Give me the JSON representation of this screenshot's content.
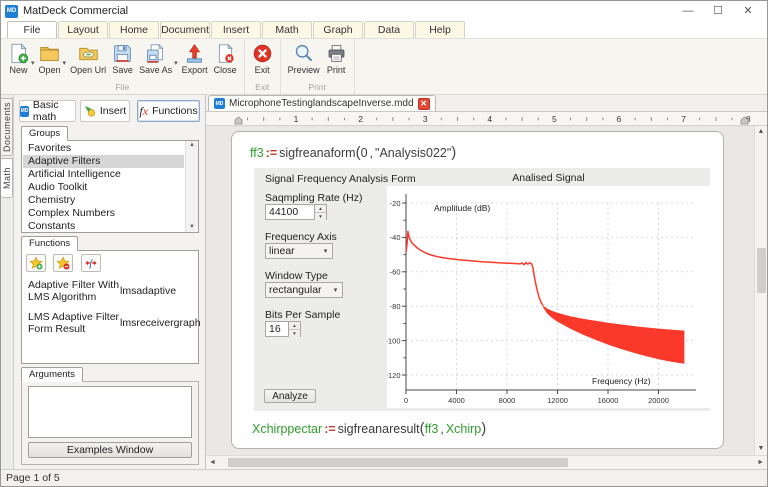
{
  "window": {
    "title": "MatDeck Commercial"
  },
  "icons": {
    "dropdown": "▾",
    "spin_up": "▲",
    "spin_down": "▼",
    "scroll_up": "▲",
    "scroll_down": "▼",
    "scroll_left": "◄",
    "scroll_right": "►",
    "minimize": "—",
    "maximize": "☐",
    "close": "✕",
    "tab_close": "✕",
    "md_logo": "MD"
  },
  "ribbon": {
    "tabs": [
      {
        "label": "File",
        "active": true
      },
      {
        "label": "Layout"
      },
      {
        "label": "Home"
      },
      {
        "label": "Document"
      },
      {
        "label": "Insert"
      },
      {
        "label": "Math"
      },
      {
        "label": "Graph"
      },
      {
        "label": "Data"
      },
      {
        "label": "Help"
      }
    ],
    "groups": [
      {
        "caption": "File",
        "buttons": [
          {
            "label": "New"
          },
          {
            "label": "Open"
          },
          {
            "label": "Open Url"
          },
          {
            "label": "Save"
          },
          {
            "label": "Save As"
          },
          {
            "label": "Export"
          },
          {
            "label": "Close"
          }
        ]
      },
      {
        "caption": "Exit",
        "buttons": [
          {
            "label": "Exit"
          }
        ]
      },
      {
        "caption": "Print",
        "buttons": [
          {
            "label": "Preview"
          },
          {
            "label": "Print"
          }
        ]
      }
    ]
  },
  "side_tabs": [
    {
      "label": "Documents"
    },
    {
      "label": "Math",
      "active": true
    }
  ],
  "left_panel": {
    "view_tabs": [
      {
        "label": "Basic math"
      },
      {
        "label": "Insert"
      },
      {
        "label": "Functions",
        "active": true
      }
    ],
    "groups": {
      "tab_label": "Groups",
      "items": [
        "Favorites",
        "Adaptive Filters",
        "Artificial Intelligence",
        "Audio Toolkit",
        "Chemistry",
        "Complex Numbers",
        "Constants"
      ],
      "selected_index": 1
    },
    "functions": {
      "tab_label": "Functions",
      "entries": [
        {
          "name": "Adaptive Filter With LMS Algorithm",
          "id": "lmsadaptive"
        },
        {
          "name": "LMS Adaptive Filter Form Result",
          "id": "lmsreceivergraph"
        }
      ]
    },
    "arguments": {
      "tab_label": "Arguments",
      "examples_button": "Examples Window"
    }
  },
  "document": {
    "tab": {
      "filename": "MicrophoneTestinglandscapeInverse.mdd"
    },
    "ruler_numbers": [
      "1",
      "2",
      "3",
      "4",
      "5",
      "6",
      "7",
      "8"
    ],
    "formula1": {
      "lhs": "ff3",
      "assign": ":=",
      "func": "sigfreanaform",
      "open": "(",
      "arg1": "0",
      "comma": ",",
      "arg2": "\"Analysis022\"",
      "close": ")"
    },
    "formula2": {
      "lhs": "Xchirppectar",
      "assign": ":=",
      "func": "sigfreanaresult",
      "open": "(",
      "arg1": "ff3",
      "comma": ",",
      "arg2": "Xchirp",
      "close": ")"
    },
    "form": {
      "title": "Signal Frequency Analysis Form",
      "sampling_rate": {
        "label": "Saqmpling Rate (Hz)",
        "value": "44100"
      },
      "frequency_axis": {
        "label": "Frequency Axis",
        "value": "linear"
      },
      "window_type": {
        "label": "Window Type",
        "value": "rectangular"
      },
      "bits_per_sample": {
        "label": "Bits Per Sample",
        "value": "16"
      },
      "analyze_button": "Analyze"
    }
  },
  "status_bar": {
    "text": "Page 1 of 5"
  },
  "chart_data": {
    "type": "area",
    "title": "Analised Signal",
    "xlabel": "Frequency (Hz)",
    "ylabel": "Amplitude (dB)",
    "xlim": [
      0,
      22300
    ],
    "ylim": [
      -130,
      -15
    ],
    "x_ticks": [
      0,
      4000,
      8000,
      12000,
      16000,
      20000
    ],
    "y_ticks": [
      -20,
      -40,
      -60,
      -80,
      -100,
      -120
    ],
    "grid": true,
    "legend": "none",
    "line_color": "#fa392a",
    "curve": [
      [
        0,
        -48.5
      ],
      [
        80,
        -44
      ],
      [
        150,
        -36.5
      ],
      [
        250,
        -40
      ],
      [
        400,
        -42.5
      ],
      [
        600,
        -44.2
      ],
      [
        900,
        -46.2
      ],
      [
        1200,
        -47.6
      ],
      [
        1600,
        -49.2
      ],
      [
        2000,
        -50.3
      ],
      [
        2500,
        -51.2
      ],
      [
        3000,
        -51.9
      ],
      [
        3600,
        -52.5
      ],
      [
        4200,
        -53
      ],
      [
        5000,
        -53.5
      ],
      [
        6000,
        -54.1
      ],
      [
        7000,
        -54.6
      ],
      [
        8000,
        -55
      ],
      [
        8600,
        -55.2
      ],
      [
        9000,
        -55.4
      ],
      [
        9200,
        -54.9
      ],
      [
        9350,
        -55.9
      ],
      [
        9500,
        -54.6
      ],
      [
        9650,
        -55.6
      ],
      [
        9800,
        -54.7
      ],
      [
        9950,
        -55.4
      ],
      [
        10050,
        -57.5
      ],
      [
        10150,
        -62
      ],
      [
        10250,
        -66
      ],
      [
        10400,
        -71
      ],
      [
        10550,
        -75
      ],
      [
        10700,
        -77.8
      ],
      [
        10850,
        -79.6
      ]
    ],
    "band": {
      "x": [
        10850,
        11200,
        11600,
        12000,
        13000,
        14000,
        15000,
        16000,
        17000,
        18000,
        19000,
        20000,
        21000,
        22050
      ],
      "upper": [
        -79.6,
        -81.5,
        -82.8,
        -83.8,
        -85.8,
        -87.3,
        -88.5,
        -89.6,
        -90.6,
        -91.5,
        -92.3,
        -93,
        -93.6,
        -94.2
      ],
      "lower": [
        -80.6,
        -84.5,
        -87,
        -89,
        -93,
        -96.5,
        -99.5,
        -102.3,
        -104.8,
        -107,
        -109,
        -110.8,
        -112.3,
        -113.5
      ]
    }
  }
}
